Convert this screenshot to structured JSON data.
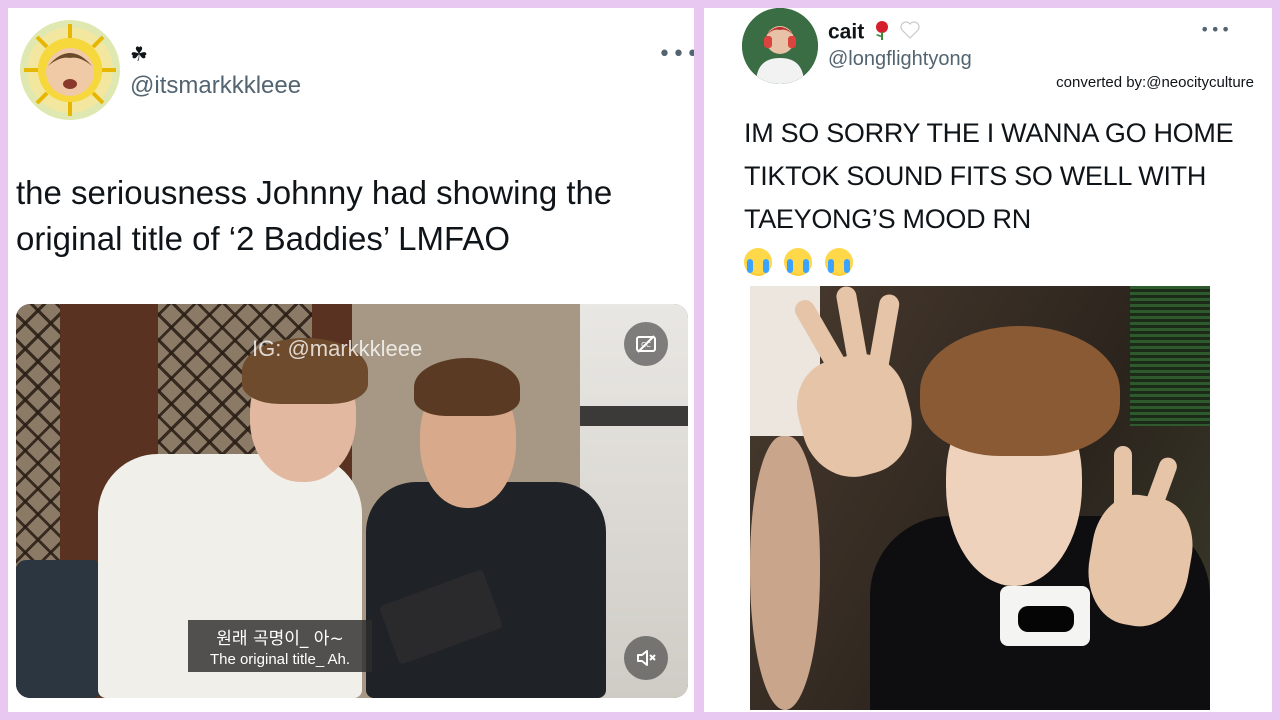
{
  "left_tweet": {
    "display_name": "☘",
    "handle": "@itsmarkkkleee",
    "more_label": "•••",
    "text": "the seriousness Johnny had showing the original title of ‘2 Baddies’ LMFAO",
    "video": {
      "watermark": "IG: @markkkleee",
      "subtitle_korean": "원래 곡명이_ 아~",
      "subtitle_english": "The original title_ Ah.",
      "cc_icon": "closed-captions-off-icon",
      "volume_icon": "volume-muted-icon"
    }
  },
  "right_tweet": {
    "display_name": "cait",
    "name_emojis": [
      "rose-emoji",
      "white-heart-emoji"
    ],
    "handle": "@longflightyong",
    "more_label": "•••",
    "converted_by": "converted by:@neocityculture",
    "text": "IM SO SORRY THE I WANNA GO HOME TIKTOK SOUND FITS SO WELL WITH TAEYONG’S MOOD RN",
    "trailing_emojis": [
      "loudly-crying-face-emoji",
      "loudly-crying-face-emoji",
      "loudly-crying-face-emoji"
    ]
  },
  "colors": {
    "background": "#e8c8f0",
    "text_primary": "#0f1419",
    "text_secondary": "#536471"
  }
}
